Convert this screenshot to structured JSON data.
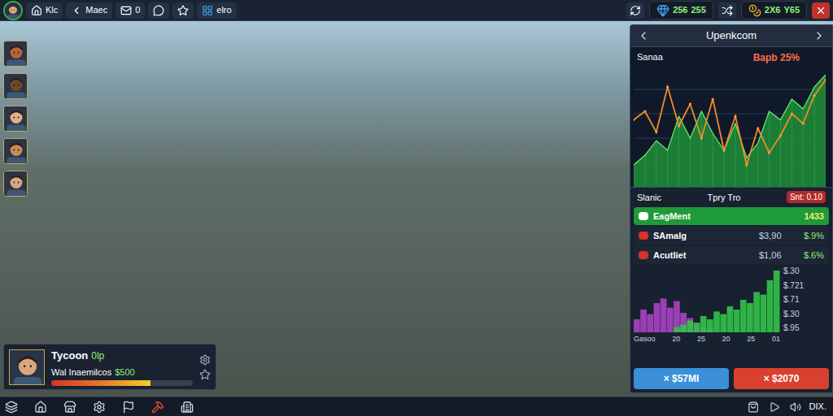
{
  "topbar": {
    "left": [
      {
        "kind": "home",
        "label": "Klc"
      },
      {
        "kind": "back",
        "label": "Maec"
      },
      {
        "kind": "mail",
        "label": "0"
      },
      {
        "kind": "chat"
      },
      {
        "kind": "star"
      },
      {
        "kind": "app",
        "label": "elro"
      }
    ],
    "controls": [
      {
        "kind": "refresh"
      },
      {
        "kind": "shuffle"
      },
      {
        "kind": "close"
      }
    ],
    "resources": [
      {
        "kind": "gem",
        "amount": "256",
        "rate": "255"
      },
      {
        "kind": "coin",
        "amount": "2X6",
        "rate": "Y65"
      }
    ]
  },
  "portraits": [
    {
      "color": "#b5643c"
    },
    {
      "color": "#6b4a2a"
    },
    {
      "color": "#e0b08a"
    },
    {
      "color": "#c98b55"
    },
    {
      "color": "#d9a77f"
    }
  ],
  "panel": {
    "title": "Upenkcom",
    "chart": {
      "label": "Sanaa",
      "change": "Bapb 25%",
      "line": [
        55,
        62,
        45,
        82,
        50,
        68,
        40,
        72,
        30,
        58,
        18,
        48,
        28,
        42,
        60,
        52,
        75,
        88
      ],
      "area": [
        18,
        26,
        38,
        30,
        58,
        40,
        62,
        44,
        30,
        52,
        24,
        36,
        62,
        55,
        72,
        64,
        82,
        92
      ]
    },
    "section": {
      "title": "Slanic",
      "subtitle": "Tpry Tro",
      "badge": "Snt: 0.10"
    },
    "rows": [
      {
        "name": "EagMent",
        "value": "1433",
        "selected": true
      },
      {
        "name": "SAmalg",
        "price": "$3,90",
        "change": "$.9%",
        "selected": false
      },
      {
        "name": "Acutliet",
        "price": "$1,06",
        "change": "$.6%",
        "selected": false
      }
    ],
    "bars": {
      "purple": [
        20,
        35,
        28,
        45,
        52,
        38,
        48,
        30,
        22,
        12,
        8,
        5,
        0,
        0,
        0,
        0,
        0,
        0,
        0,
        0,
        0,
        0
      ],
      "green": [
        0,
        0,
        0,
        0,
        0,
        0,
        8,
        12,
        18,
        15,
        25,
        20,
        32,
        28,
        40,
        35,
        50,
        45,
        62,
        58,
        80,
        95
      ],
      "y_ticks": [
        "$.30",
        "$.721",
        "$.71",
        "$.30",
        "$.95"
      ],
      "x_ticks": [
        "Gasoo",
        "20",
        "25",
        "20",
        "25",
        "01"
      ]
    },
    "buttons": [
      {
        "label": "× $57MI",
        "color": "#3b8fd9"
      },
      {
        "label": "× $2070",
        "color": "#d9412e"
      }
    ]
  },
  "player": {
    "name": "Tycoon",
    "tag": "0lp",
    "title": "Wal Inaemilcos",
    "amount": "$500",
    "level": 0.7
  },
  "bottombar": {
    "left": [
      {
        "kind": "layers"
      },
      {
        "kind": "home"
      },
      {
        "kind": "store"
      },
      {
        "kind": "settings"
      },
      {
        "kind": "flag"
      },
      {
        "kind": "hammer"
      },
      {
        "kind": "building"
      }
    ],
    "right": [
      {
        "kind": "shop"
      },
      {
        "kind": "play"
      },
      {
        "kind": "volume"
      }
    ],
    "label": "DIX."
  }
}
